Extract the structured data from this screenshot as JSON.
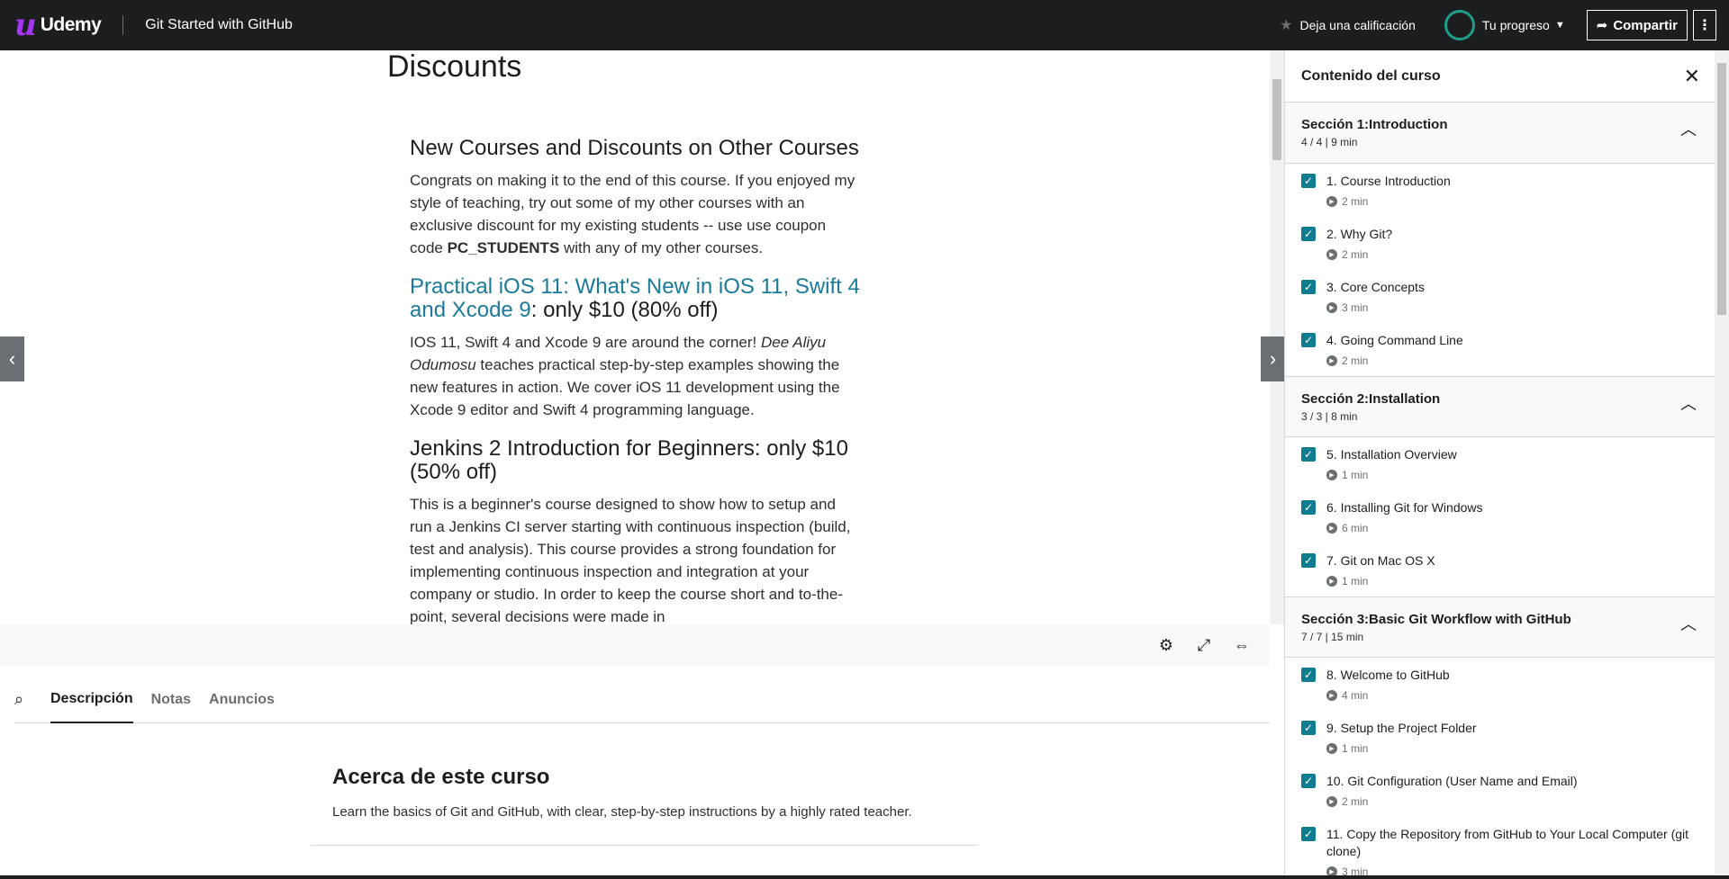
{
  "header": {
    "logo_text": "Udemy",
    "course_title": "Git Started with GitHub",
    "rating_label": "Deja una calificación",
    "progress_label": "Tu progreso",
    "share_label": "Compartir"
  },
  "lecture": {
    "page_heading": "Discounts",
    "sections": [
      {
        "title": "New Courses and Discounts on Other Courses",
        "body_pre": "Congrats on making it to the end of this course. If you enjoyed my style of teaching, try out some of my other courses with an exclusive discount for my existing students -- use use coupon code ",
        "body_strong": "PC_STUDENTS",
        "body_post": " with any of my other courses."
      },
      {
        "title_link": "Practical iOS 11: What's New in iOS 11, Swift 4 and Xcode 9",
        "title_rest": ": only $10 (80% off)",
        "body_pre": "IOS 11, Swift 4 and Xcode 9 are around the corner! ",
        "body_em": "Dee Aliyu Odumosu",
        "body_post": " teaches practical step-by-step examples showing the new features in action. We cover iOS 11 development using the Xcode 9 editor and Swift 4 programming language."
      },
      {
        "title": "Jenkins 2 Introduction for Beginners: only $10 (50% off)",
        "body": "This is a beginner's course designed to show how to setup and run a Jenkins CI server starting with continuous inspection (build, test and analysis). This course provides a strong foundation for implementing continuous inspection and integration at your company or studio. In order to keep the course short and to-the-point, several decisions were made in"
      }
    ]
  },
  "tabs": {
    "items": [
      "Descripción",
      "Notas",
      "Anuncios"
    ],
    "active": "Descripción"
  },
  "about": {
    "title": "Acerca de este curso",
    "text": "Learn the basics of Git and GitHub, with clear, step-by-step instructions by a highly rated teacher."
  },
  "sidebar": {
    "title": "Contenido del curso",
    "sections": [
      {
        "title": "Sección 1:Introduction",
        "meta": "4 / 4 | 9 min",
        "lectures": [
          {
            "title": "1. Course Introduction",
            "duration": "2 min"
          },
          {
            "title": "2. Why Git?",
            "duration": "2 min"
          },
          {
            "title": "3. Core Concepts",
            "duration": "3 min"
          },
          {
            "title": "4. Going Command Line",
            "duration": "2 min"
          }
        ]
      },
      {
        "title": "Sección 2:Installation",
        "meta": "3 / 3 | 8 min",
        "lectures": [
          {
            "title": "5. Installation Overview",
            "duration": "1 min"
          },
          {
            "title": "6. Installing Git for Windows",
            "duration": "6 min"
          },
          {
            "title": "7. Git on Mac OS X",
            "duration": "1 min"
          }
        ]
      },
      {
        "title": "Sección 3:Basic Git Workflow with GitHub",
        "meta": "7 / 7 | 15 min",
        "lectures": [
          {
            "title": "8. Welcome to GitHub",
            "duration": "4 min"
          },
          {
            "title": "9. Setup the Project Folder",
            "duration": "1 min"
          },
          {
            "title": "10. Git Configuration (User Name and Email)",
            "duration": "2 min"
          },
          {
            "title": "11. Copy the Repository from GitHub to Your Local Computer (git clone)",
            "duration": "3 min"
          }
        ]
      }
    ]
  },
  "colors": {
    "header_bg": "#1c1d1f",
    "accent_purple": "#a435f0",
    "progress_teal": "#1e9e8a",
    "checkbox_teal": "#0f7c90",
    "link_blue": "#1a7a9a"
  }
}
